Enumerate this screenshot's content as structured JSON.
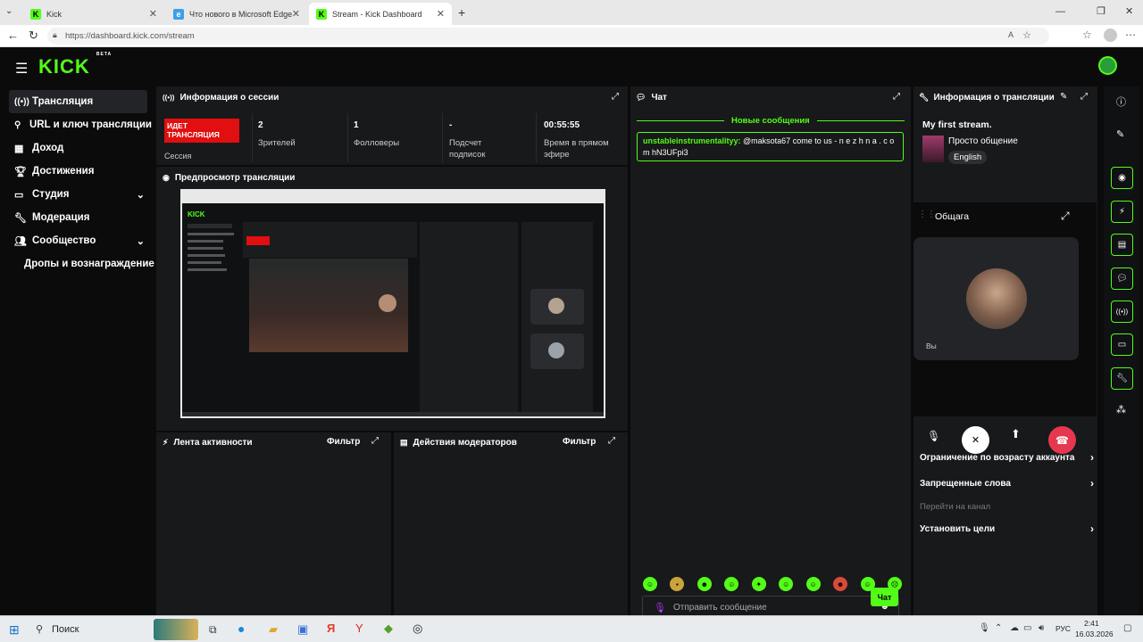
{
  "browser": {
    "tabs": [
      {
        "title": "Kick"
      },
      {
        "title": "Что нового в Microsoft Edge"
      },
      {
        "title": "Stream - Kick Dashboard"
      }
    ],
    "url": "https://dashboard.kick.com/stream"
  },
  "header": {
    "logo": "KICK",
    "beta": "BETA"
  },
  "sidebar": {
    "items": [
      {
        "label": "Трансляция"
      },
      {
        "label": "URL и ключ трансляции"
      },
      {
        "label": "Доход"
      },
      {
        "label": "Достижения"
      },
      {
        "label": "Студия"
      },
      {
        "label": "Модерация"
      },
      {
        "label": "Сообщество"
      },
      {
        "label": "Дропы и вознаграждение"
      }
    ]
  },
  "session": {
    "title": "Информация о сессии",
    "live_badge": "ИДЕТ ТРАНСЛЯЦИЯ",
    "session_label": "Сессия",
    "stats": [
      {
        "value": "2",
        "label": "Зрителей"
      },
      {
        "value": "1",
        "label": "Фолловеры"
      },
      {
        "value": "-",
        "label": "Подсчет подписок"
      },
      {
        "value": "00:55:55",
        "label": "Время в прямом эфире"
      }
    ]
  },
  "preview": {
    "title": "Предпросмотр трансляции"
  },
  "activity": {
    "title": "Лента активности",
    "filter": "Фильтр"
  },
  "modactions": {
    "title": "Действия модераторов",
    "filter": "Фильтр"
  },
  "chat": {
    "title": "Чат",
    "new_messages": "Новые сообщения",
    "messages": [
      {
        "user": "unstableinstrumentalityy:",
        "text": " @maksota67 come to us - n e z h n a . c o m hN3UFpi3"
      }
    ],
    "placeholder": "Отправить сообщение",
    "send": "Чат"
  },
  "streaminfo": {
    "title": "Информация о трансляции",
    "stream_title": "My first stream.",
    "category": "Просто общение",
    "language": "English",
    "items": [
      {
        "label": "Ограничение по возрасту аккаунта"
      },
      {
        "label": "Запрещенные слова"
      },
      {
        "label": "Перейти на канал"
      },
      {
        "label": "Установить цели"
      }
    ]
  },
  "call": {
    "title": "Общага",
    "you_label": "Вы"
  },
  "taskbar": {
    "search": "Поиск",
    "lang": "РУС",
    "time": "2:41",
    "date": "16.03.2026"
  },
  "colors": {
    "accent": "#53fc18",
    "live": "#e10f0f",
    "hangup": "#e5384f"
  }
}
